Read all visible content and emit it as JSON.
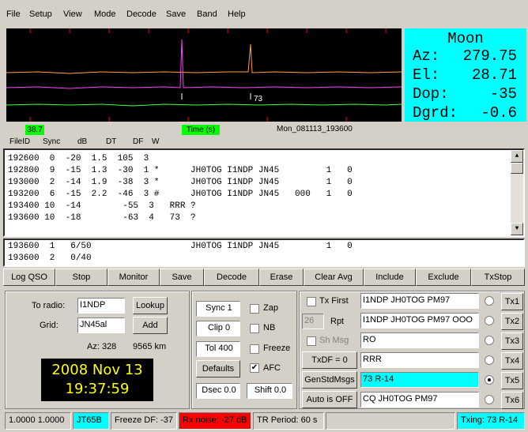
{
  "menu": [
    "File",
    "Setup",
    "View",
    "Mode",
    "Decode",
    "Save",
    "Band",
    "Help"
  ],
  "moon": {
    "title": "Moon",
    "rows": [
      {
        "k": "Az:",
        "v": "279.75"
      },
      {
        "k": "El:",
        "v": "28.71"
      },
      {
        "k": "Dop:",
        "v": "-35"
      },
      {
        "k": "Dgrd:",
        "v": "-0.6"
      }
    ]
  },
  "waterfall": {
    "marker_label": "73"
  },
  "below_wf": {
    "left_value": "38.7",
    "time_label": "Time (s)",
    "file_label": "Mon_081113_193600"
  },
  "columns": [
    "FileID",
    "Sync",
    "dB",
    "DT",
    "DF",
    "W"
  ],
  "decoded": [
    "192600  0  -20  1.5  105  3",
    "192800  9  -15  1.3  -30  1 *      JH0TOG I1NDP JN45         1   0",
    "193000  2  -14  1.9  -38  3 *      JH0TOG I1NDP JN45         1   0",
    "193200  6  -15  2.2  -46  3 #      JH0TOG I1NDP JN45   000   1   0",
    "193400 10  -14        -55  3   RRR ?",
    "193600 10  -18        -63  4   73  ?"
  ],
  "averaged": [
    "193600  1   6/50                   JH0TOG I1NDP JN45         1   0",
    "193600  2   0/40"
  ],
  "buttons": [
    "Log QSO",
    "Stop",
    "Monitor",
    "Save",
    "Decode",
    "Erase",
    "Clear Avg",
    "Include",
    "Exclude",
    "TxStop"
  ],
  "left_panel": {
    "to_radio_label": "To radio:",
    "to_radio": "I1NDP",
    "lookup": "Lookup",
    "grid_label": "Grid:",
    "grid": "JN45al",
    "add": "Add",
    "az": "Az: 328",
    "dist": "9565 km",
    "date": "2008 Nov 13",
    "time": "19:37:59"
  },
  "mid_panel": {
    "sync": "Sync  1",
    "clip": "Clip  0",
    "tol": "Tol   400",
    "defaults": "Defaults",
    "dsec": "Dsec  0.0",
    "shift": "Shift 0.0",
    "zap": "Zap",
    "nb": "NB",
    "freeze": "Freeze",
    "afc": "AFC"
  },
  "right_panel": {
    "tx_first": "Tx First",
    "rpt_value": "26",
    "rpt": "Rpt",
    "sh_msg": "Sh Msg",
    "txdf": "TxDF = 0",
    "gen": "GenStdMsgs",
    "auto": "Auto is OFF",
    "msgs": [
      "I1NDP JH0TOG PM97",
      "I1NDP JH0TOG PM97 OOO",
      "RO",
      "RRR",
      "73 R-14",
      "CQ JH0TOG PM97"
    ],
    "tx_buttons": [
      "Tx1",
      "Tx2",
      "Tx3",
      "Tx4",
      "Tx5",
      "Tx6"
    ],
    "selected": 4
  },
  "status": {
    "s1": "1.0000  1.0000",
    "mode": "JT65B",
    "freeze": "Freeze DF:  -37",
    "rx": "Rx noise: -27 dB",
    "tr": "TR Period: 60 s",
    "txing": "Txing:  73 R-14"
  },
  "colors": {
    "moon_bg": "#00ffff",
    "mode_bg": "#00ffff",
    "rx_bg": "#ff0000",
    "txing_bg": "#00ffff",
    "selected_msg_bg": "#00ffff",
    "clock_fg": "#ffff00"
  }
}
